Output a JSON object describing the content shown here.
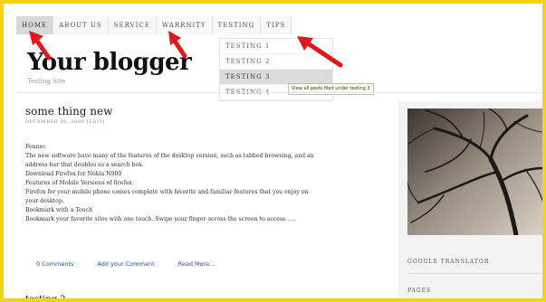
{
  "nav": {
    "items": [
      "HOME",
      "ABOUT US",
      "SERVICE",
      "WARRNITY",
      "TESTING",
      "TIPS"
    ],
    "active_index": 0
  },
  "dropdown": {
    "items": [
      "TESTING 1",
      "TESTING 2",
      "TESTING 3",
      "TESTING 4"
    ],
    "hover_index": 2,
    "tooltip": "View all posts filed under testing 3"
  },
  "site": {
    "title": "Your blogger",
    "subtitle": "Testing Site"
  },
  "post": {
    "title": "some thing new",
    "meta": "DECEMBER 20, 2009   [EDIT]",
    "body": [
      "Fennec",
      "The new software have many of the features of the desktop version, such as tabbed browsing, and an",
      "address bar that doubles as a search box.",
      "Download Firefox for Nokia N900",
      "Features of  Mobile Versions of firefox",
      "Firefox for your mobile phone comes complete with favorite and familiar features that you enjoy on",
      "your desktop.",
      "Bookmark with a Touch",
      "Bookmark your favorite sites with one touch..Swipe your finger across the screen to access ....."
    ],
    "links": [
      "0 Comments",
      "Add your Comment",
      "Read More..."
    ]
  },
  "next_post": {
    "title": "testing 2"
  },
  "sidebar": {
    "translator_label": "GOOGLE TRANSLATOR",
    "pages_label": "PAGES"
  },
  "colors": {
    "frame_border": "#f3d21a",
    "annotation_arrow": "#e0191b",
    "link_blue": "#2a4ccf"
  }
}
